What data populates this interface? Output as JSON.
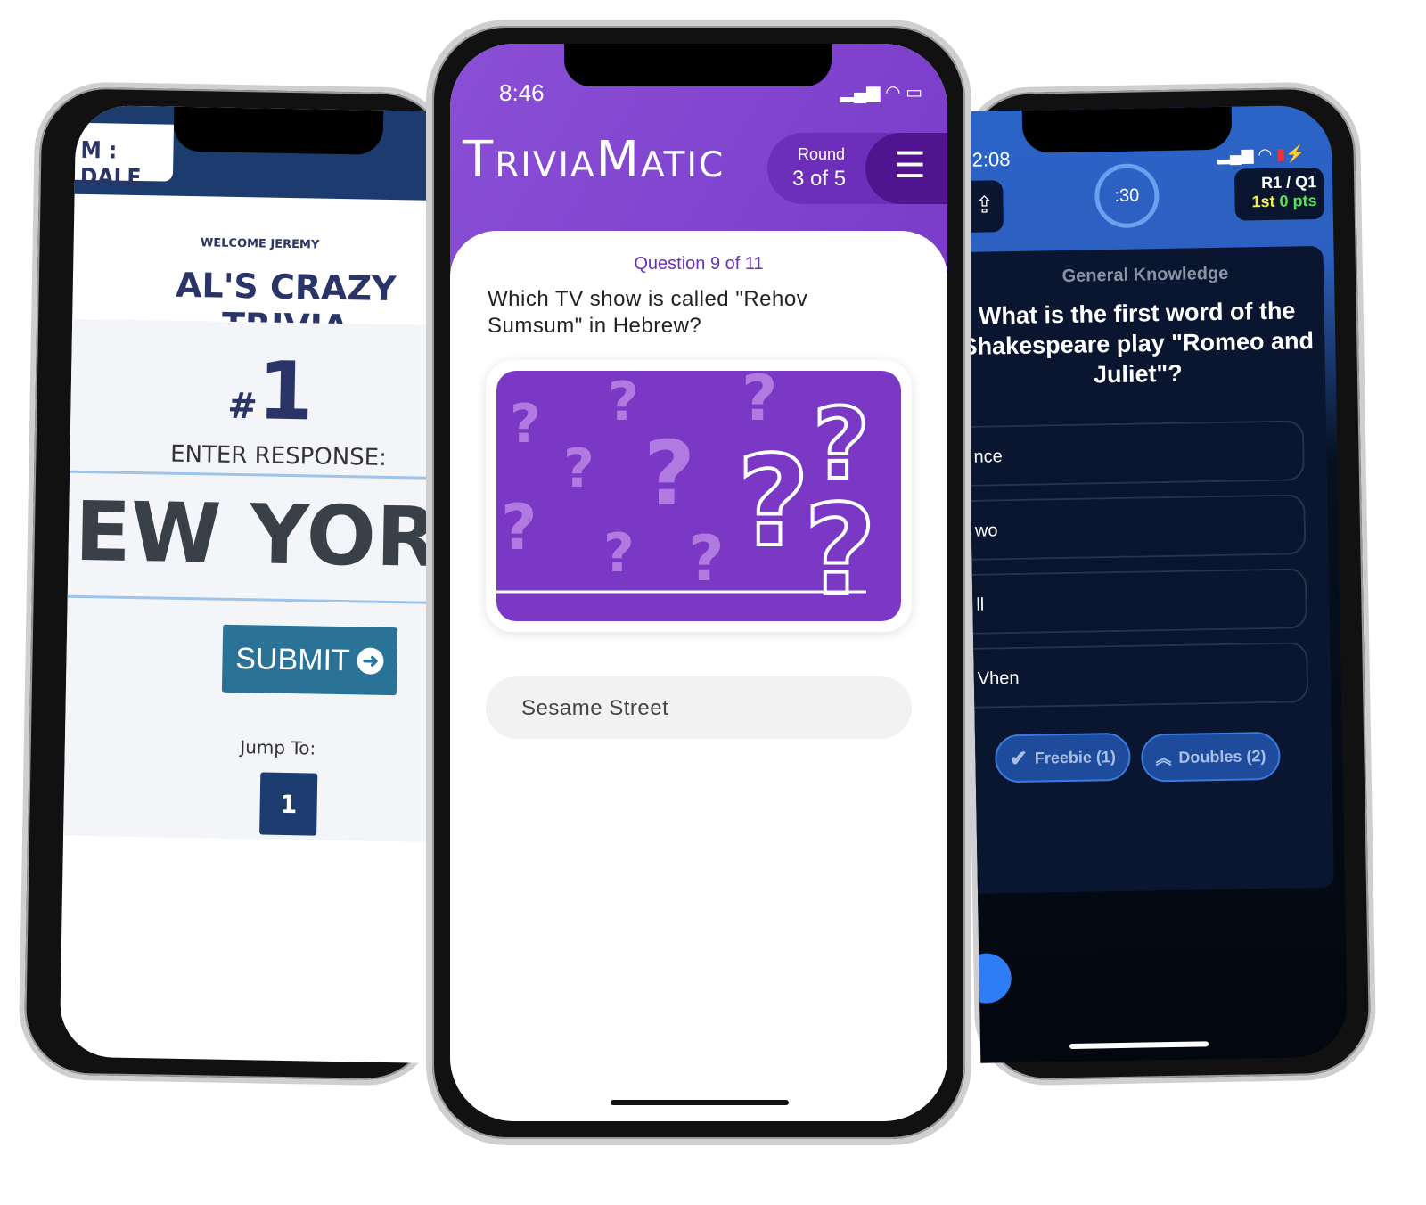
{
  "left_phone": {
    "team_label": "M : DALE",
    "welcome": "WELCOME JEREMY",
    "title": "AL'S CRAZY TRIVIA",
    "rank_hash": "#",
    "rank": "1",
    "enter_response": "ENTER RESPONSE:",
    "response": "NEW YORK",
    "submit": "SUBMIT",
    "jump_to": "Jump To:",
    "jump_buttons": [
      "1"
    ],
    "colors": {
      "header": "#1c3c70",
      "submit": "#2a7396"
    }
  },
  "center_phone": {
    "status": {
      "time": "8:46"
    },
    "brand": "TriviaMatic",
    "round_label": "Round",
    "round_value": "3 of 5",
    "question_counter": "Question 9 of 11",
    "question": "Which TV show is called \"Rehov Sumsum\" in Hebrew?",
    "image_icon": "question-marks-illustration",
    "answer": "Sesame Street",
    "colors": {
      "accent": "#7a3cc9"
    }
  },
  "right_phone": {
    "status": {
      "time": "2:08"
    },
    "timer": ":30",
    "round_question": "R1 / Q1",
    "place": "1st",
    "points": "0 pts",
    "category": "General Knowledge",
    "question": "What is the first word of the Shakespeare play \"Romeo and Juliet\"?",
    "answers": [
      "nce",
      "wo",
      "ll",
      "Vhen"
    ],
    "freebie": "Freebie (1)",
    "doubles": "Doubles (2)",
    "colors": {
      "place": "#f4f04a",
      "points": "#5ee05a",
      "header": "#2b64c8"
    }
  }
}
